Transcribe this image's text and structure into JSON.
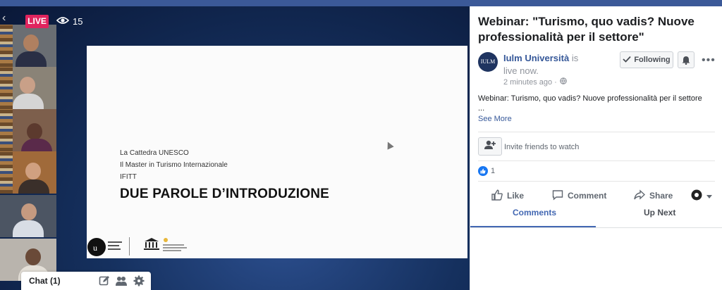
{
  "top_bar": {
    "color": "#3b5998"
  },
  "video": {
    "live_badge": "LIVE",
    "viewer_count": "15",
    "icons": {
      "viewers": "eye-icon",
      "back": "back-arrow-icon"
    },
    "slide": {
      "lines": [
        "La Cattedra UNESCO",
        "Il Master in Turismo Internazionale",
        "IFITT"
      ],
      "title": "DUE PAROLE D’INTRODUZIONE",
      "logo_text": "Università della Svizzera italiana"
    },
    "participants": [
      {
        "name": "participant-1"
      },
      {
        "name": "participant-2"
      },
      {
        "name": "participant-3"
      },
      {
        "name": "participant-4"
      },
      {
        "name": "participant-5"
      },
      {
        "name": "participant-6"
      }
    ]
  },
  "chat": {
    "label": "Chat (1)",
    "icons": [
      "compose-icon",
      "people-icon",
      "settings-icon"
    ]
  },
  "panel": {
    "title": "Webinar: \"Turismo, quo vadis? Nuove professionalità per il settore\"",
    "author": {
      "name": "Iulm Università",
      "status": "is live now.",
      "avatar_text": "IULM",
      "time": "2 minutes ago ·"
    },
    "following_label": "Following",
    "description": "Webinar: Turismo, quo vadis? Nuove professionalità per il settore",
    "description_ellipsis": "...",
    "see_more": "See More",
    "invite_label": "Invite friends to watch",
    "reactions_count": "1",
    "actions": {
      "like": "Like",
      "comment": "Comment",
      "share": "Share"
    },
    "tabs": {
      "comments": "Comments",
      "up_next": "Up Next"
    },
    "colors": {
      "link": "#365899",
      "accent": "#4267b2",
      "like_blue": "#1877f2",
      "live_red": "#e0245e"
    }
  }
}
